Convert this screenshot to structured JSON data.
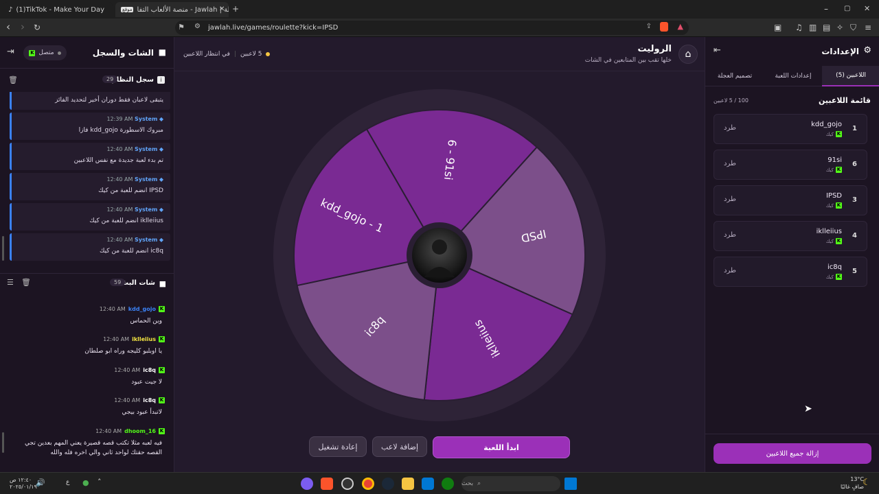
{
  "browser": {
    "tabs": [
      {
        "title": "(1)TikTok - Make Your Day",
        "active": false
      },
      {
        "title": "جولة | Jawlah - منصة الألعاب التفا",
        "badge": "موقع",
        "active": true
      }
    ],
    "url": "jawlah.live/games/roulette?kick=IPSD",
    "new_tab": "+"
  },
  "left": {
    "title": "الشات والسجل",
    "status": "متصل",
    "system_log": {
      "title": "سجل النظام",
      "count": "29",
      "messages": [
        {
          "name": "",
          "time": "",
          "text": "يتبقى لاعبان فقط دوران أخير لتحديد الفائز"
        },
        {
          "name": "System",
          "time": "12:39 AM",
          "text": "مبروك الاسطورة kdd_gojo فازا"
        },
        {
          "name": "System",
          "time": "12:40 AM",
          "text": "تم بدء لعبة جديدة مع نفس اللاعبين"
        },
        {
          "name": "System",
          "time": "12:40 AM",
          "text": "IPSD انضم للعبة من كيك"
        },
        {
          "name": "System",
          "time": "12:40 AM",
          "text": "iklleiius انضم للعبة من كيك"
        },
        {
          "name": "System",
          "time": "12:40 AM",
          "text": "ic8q انضم للعبة من كيك"
        }
      ]
    },
    "stream_chat": {
      "title": "شات البث",
      "count": "59",
      "messages": [
        {
          "name": "kdd_gojo",
          "time": "12:40 AM",
          "text": "وين الحماس",
          "color": "#3b82f6"
        },
        {
          "name": "iklleiius",
          "time": "12:40 AM",
          "text": "يا اوبلبو كليجه وراه ابو صلطان",
          "color": "#f5e642"
        },
        {
          "name": "ic8q",
          "time": "12:40 AM",
          "text": "لا جيت عبود",
          "color": "#ffffff"
        },
        {
          "name": "ic8q",
          "time": "12:40 AM",
          "text": "لاتبدأ عبود بيجي",
          "color": "#ffffff"
        },
        {
          "name": "dhoom_16",
          "time": "12:40 AM",
          "text": "فيه لعبه مثلا تكتب قصه قصيرة يعني المهم بعدين تجي",
          "text2": "القصه حقتك لواحد ثاني والي اخره فله والله",
          "color": "#53fc18"
        }
      ]
    }
  },
  "main": {
    "title": "الروليت",
    "subtitle": "خلها تقب بين المتابعين في الشات",
    "players_count": "5 لاعبين",
    "status": "في انتظار اللاعبين",
    "wheel_segments": [
      "6 - 91si",
      "IPSD",
      "iklleiius",
      "ic8q",
      "kdd_gojo - 1"
    ],
    "buttons": {
      "start": "ابدأ اللعبة",
      "add": "إضافة لاعب",
      "restart": "إعادة تشغيل"
    }
  },
  "right": {
    "title": "الإعدادات",
    "tabs": [
      "اللاعبين (5)",
      "إعدادات اللعبة",
      "تصميم العجلة"
    ],
    "list_title": "قائمة اللاعبين",
    "list_count": "100 / 5 لاعبين",
    "players": [
      {
        "num": "1",
        "name": "kdd_gojo",
        "platform": "كيك",
        "kick": "طرد"
      },
      {
        "num": "6",
        "name": "91si",
        "platform": "كيك",
        "kick": "طرد"
      },
      {
        "num": "3",
        "name": "IPSD",
        "platform": "كيك",
        "kick": "طرد"
      },
      {
        "num": "4",
        "name": "iklleiius",
        "platform": "كيك",
        "kick": "طرد"
      },
      {
        "num": "5",
        "name": "ic8q",
        "platform": "كيك",
        "kick": "طرد"
      }
    ],
    "remove_all": "إزالة جميع اللاعبين"
  },
  "taskbar": {
    "search": "بحث",
    "weather_temp": "13°C",
    "weather_desc": "صافٍ غالبًا",
    "time": "١٢:٤٠ ص",
    "date": "٢٠٢٥/٠١/١٩"
  },
  "colors": {
    "accent": "#9b30b8",
    "wheel_dark": "#7a2a93",
    "wheel_light": "#7c4f8a",
    "kick": "#53fc18"
  }
}
